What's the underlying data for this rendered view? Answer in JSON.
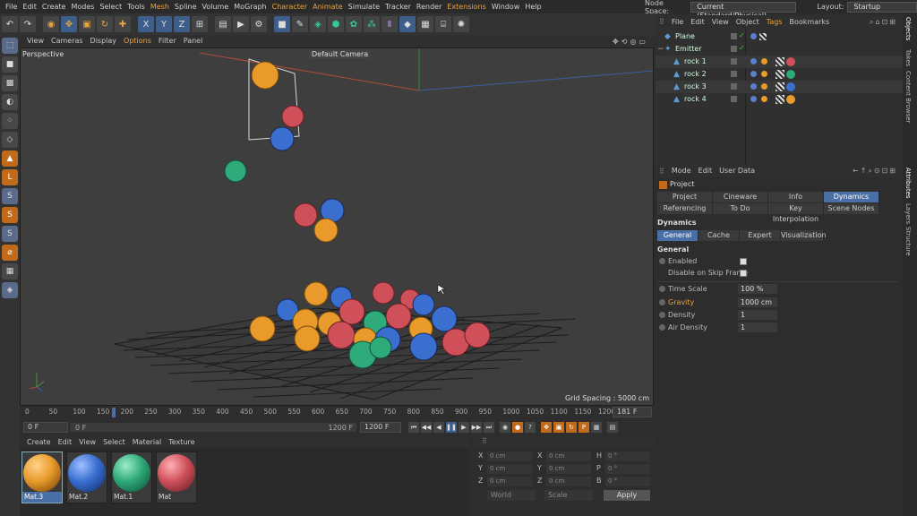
{
  "menubar": {
    "items": [
      "File",
      "Edit",
      "Create",
      "Modes",
      "Select",
      "Tools",
      "Mesh",
      "Spline",
      "Volume",
      "MoGraph",
      "Character",
      "Animate",
      "Simulate",
      "Tracker",
      "Render",
      "Extensions",
      "Window",
      "Help"
    ],
    "node_space_label": "Node Space:",
    "node_space_value": "Current (Standard/Physical)",
    "layout_label": "Layout:",
    "layout_value": "Startup"
  },
  "toolbar": {
    "icons": [
      "undo-icon",
      "redo-icon",
      "live-select-icon",
      "move-icon",
      "scale-icon",
      "rotate-icon",
      "add-icon",
      "x-axis-icon",
      "y-axis-icon",
      "z-axis-icon",
      "coord-system-icon",
      "render-region-icon",
      "render-view-icon",
      "render-settings-icon",
      "cube-icon",
      "pen-icon",
      "subdivision-icon",
      "extrude-icon",
      "cloner-icon",
      "deformer-icon",
      "bend-icon",
      "environment-icon",
      "scene-icon",
      "camera-icon",
      "light-icon"
    ]
  },
  "viewport": {
    "menu": [
      "View",
      "Cameras",
      "Display",
      "Options",
      "Filter",
      "Panel"
    ],
    "projection": "Perspective",
    "camera": "Default Camera",
    "grid_spacing": "Grid Spacing : 5000 cm"
  },
  "timeline": {
    "ticks": [
      "0",
      "50",
      "100",
      "150",
      "200",
      "250",
      "300",
      "350",
      "400",
      "450",
      "500",
      "550",
      "600",
      "650",
      "700",
      "750",
      "800",
      "850",
      "900",
      "950",
      "1000",
      "1050",
      "1100",
      "1150",
      "1200"
    ],
    "current_frame": "181 F",
    "start_field": "0 F",
    "preview_start": "0 F",
    "preview_end": "1200 F",
    "end_field": "1200 F"
  },
  "materials": {
    "menu": [
      "Create",
      "Edit",
      "View",
      "Select",
      "Material",
      "Texture"
    ],
    "items": [
      {
        "name": "Mat.3",
        "color": "#e89a2a"
      },
      {
        "name": "Mat.2",
        "color": "#3a6fd0"
      },
      {
        "name": "Mat.1",
        "color": "#2faa7a"
      },
      {
        "name": "Mat",
        "color": "#d0505a"
      }
    ]
  },
  "coordinates": {
    "rows": [
      [
        {
          "label": "X",
          "value": "0 cm"
        },
        {
          "label": "X",
          "value": "0 cm"
        },
        {
          "label": "H",
          "value": "0 °"
        }
      ],
      [
        {
          "label": "Y",
          "value": "0 cm"
        },
        {
          "label": "Y",
          "value": "0 cm"
        },
        {
          "label": "P",
          "value": "0 °"
        }
      ],
      [
        {
          "label": "Z",
          "value": "0 cm"
        },
        {
          "label": "Z",
          "value": "0 cm"
        },
        {
          "label": "B",
          "value": "0 °"
        }
      ]
    ],
    "mode": "World",
    "size_mode": "Scale",
    "apply": "Apply"
  },
  "objects": {
    "menu": [
      "File",
      "Edit",
      "View",
      "Object",
      "Tags",
      "Bookmarks"
    ],
    "items": [
      {
        "name": "Plane",
        "indent": 0,
        "tags": []
      },
      {
        "name": "Emitter",
        "indent": 0,
        "tags": []
      },
      {
        "name": "rock 1",
        "indent": 1,
        "tag_color": "#d0505a"
      },
      {
        "name": "rock 2",
        "indent": 1,
        "tag_color": "#2faa7a"
      },
      {
        "name": "rock 3",
        "indent": 1,
        "tag_color": "#3a6fd0"
      },
      {
        "name": "rock 4",
        "indent": 1,
        "tag_color": "#e89a2a"
      }
    ]
  },
  "attributes": {
    "menu": [
      "Mode",
      "Edit",
      "User Data"
    ],
    "object_title": "Project",
    "tabs_row1": [
      "Project Settings",
      "Cineware",
      "Info",
      "Dynamics"
    ],
    "tabs_row2": [
      "Referencing",
      "To Do",
      "Key Interpolation",
      "Scene Nodes"
    ],
    "section": "Dynamics",
    "subtabs": [
      "General",
      "Cache",
      "Expert",
      "Visualization"
    ],
    "group": "General",
    "enabled_label": "Enabled",
    "disable_skip_label": "Disable on Skip Frame",
    "params": [
      {
        "label": "Time Scale",
        "value": "100 %"
      },
      {
        "label": "Gravity",
        "value": "1000 cm"
      },
      {
        "label": "Density",
        "value": "1"
      },
      {
        "label": "Air Density",
        "value": "1"
      }
    ]
  },
  "side_tabs": [
    "Objects",
    "Takes",
    "Content Browser",
    "Attributes",
    "Layers",
    "Structure"
  ],
  "colors": {
    "accent": "#e8a440",
    "selected": "#4a6fa5"
  }
}
